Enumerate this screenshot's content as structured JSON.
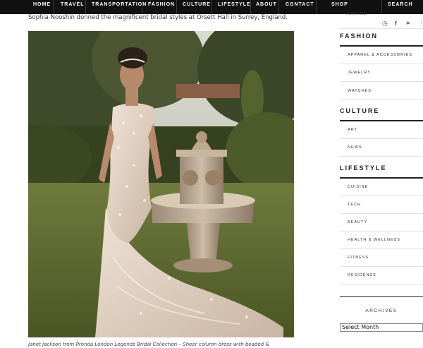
{
  "nav": {
    "items": [
      "HOME",
      "TRAVEL",
      "TRANSPORTATION",
      "FASHION",
      "CULTURE",
      "LIFESTYLE",
      "ABOUT",
      "CONTACT"
    ],
    "shop": "SHOP",
    "search": "SEARCH"
  },
  "article": {
    "intro": "Sophia Nooshin donned the magnificent bridal styles at Orsett Hall in Surrey, England.",
    "caption": "Janet Jackson from Pronda London Legends Bridal Collection – Sheer column dress with beaded & "
  },
  "sidebar": {
    "top_item": "MARINE",
    "fashion": {
      "title": "FASHION",
      "items": [
        "APPAREL & ACCESSORIES",
        "JEWELRY",
        "WATCHES"
      ]
    },
    "culture": {
      "title": "CULTURE",
      "items": [
        "ART",
        "NEWS"
      ]
    },
    "lifestyle": {
      "title": "LIFESTYLE",
      "items": [
        "CUISINE",
        "TECH",
        "BEAUTY",
        "HEALTH & WELLNESS",
        "FITNESS",
        "RESIDENCE"
      ]
    },
    "archives": {
      "title": "ARCHIVES",
      "select_value": "Select Month"
    }
  },
  "icons": [
    "instagram-icon",
    "facebook-icon",
    "twitter-icon",
    "more-icon"
  ]
}
